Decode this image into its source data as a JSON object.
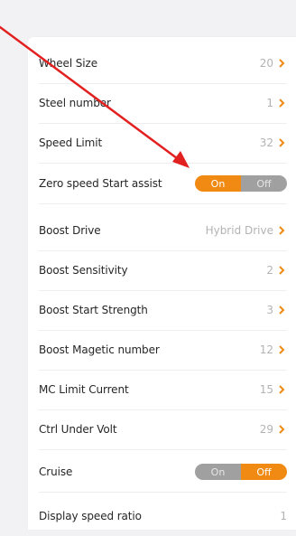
{
  "settings": [
    {
      "label": "Wheel Size",
      "value": "20",
      "type": "chevron"
    },
    {
      "label": "Steel number",
      "value": "1",
      "type": "chevron"
    },
    {
      "label": "Speed Limit",
      "value": "32",
      "type": "chevron"
    },
    {
      "label": "Zero speed Start assist",
      "type": "toggle",
      "on_label": "On",
      "off_label": "Off",
      "state": "On"
    },
    {
      "label": "Boost Drive",
      "value": "Hybrid Drive",
      "type": "chevron"
    },
    {
      "label": "Boost Sensitivity",
      "value": "2",
      "type": "chevron"
    },
    {
      "label": "Boost Start Strength",
      "value": "3",
      "type": "chevron"
    },
    {
      "label": "Boost Magetic number",
      "value": "12",
      "type": "chevron"
    },
    {
      "label": "MC Limit Current",
      "value": "15",
      "type": "chevron"
    },
    {
      "label": "Ctrl Under Volt",
      "value": "29",
      "type": "chevron"
    },
    {
      "label": "Cruise",
      "type": "toggle",
      "on_label": "On",
      "off_label": "Off",
      "state": "Off"
    },
    {
      "label": "Display speed ratio",
      "value": "1",
      "type": "plain"
    }
  ],
  "colors": {
    "accent": "#f08a12",
    "toggle_inactive": "#a0a0a0",
    "annotation_arrow": "#e32020"
  },
  "icons": {
    "chevron": "chevron-right-icon"
  }
}
